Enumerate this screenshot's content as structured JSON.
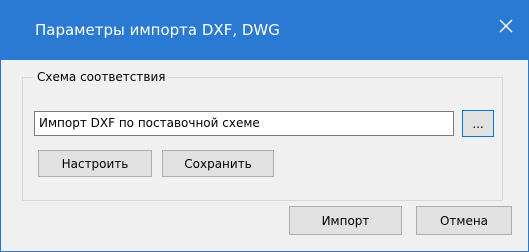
{
  "window": {
    "title": "Параметры импорта DXF, DWG",
    "close_icon": "close-icon"
  },
  "scheme_group": {
    "legend": "Схема соответствия",
    "selected_scheme": "Импорт DXF по поставочной схеме",
    "browse_label": "...",
    "configure_label": "Настроить",
    "save_label": "Сохранить"
  },
  "footer": {
    "import_label": "Импорт",
    "cancel_label": "Отмена"
  },
  "colors": {
    "titlebar": "#2a79d2",
    "background": "#f0f0f0",
    "accent_border": "#0078d7"
  }
}
